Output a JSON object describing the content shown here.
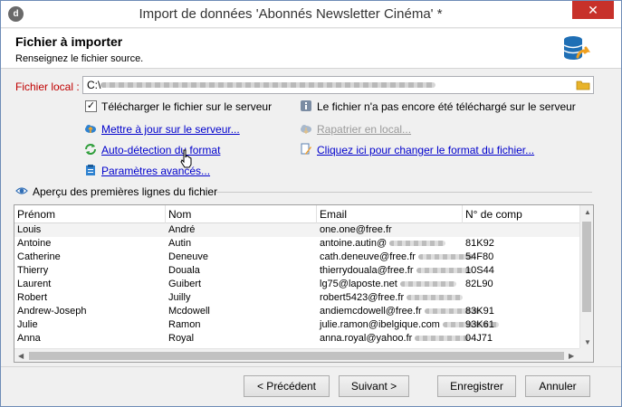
{
  "window": {
    "title": "Import de données 'Abonnés Newsletter Cinéma' *",
    "close_label": "✕",
    "app_icon_glyph": "d"
  },
  "header": {
    "title": "Fichier à importer",
    "subtitle": "Renseignez le fichier source.",
    "icon": "database-import-icon"
  },
  "file": {
    "label": "Fichier local :",
    "path_value": "C:\\"
  },
  "options": {
    "upload_checkbox_label": "Télécharger le fichier sur le serveur",
    "upload_checked": true,
    "status_text": "Le fichier n'a pas encore été téléchargé sur le serveur",
    "update_server_link": "Mettre à jour sur le serveur...",
    "repatriate_link": "Rapatrier en local...",
    "autodetect_link": "Auto-détection du format",
    "change_format_link": "Cliquez ici pour changer le format du fichier...",
    "advanced_params_link": "Paramètres avancés..."
  },
  "preview": {
    "legend": "Aperçu des premières lignes du fichier",
    "columns": [
      "Prénom",
      "Nom",
      "Email",
      "N° de comp"
    ],
    "rows": [
      [
        "Louis",
        "André",
        "one.one@free.fr",
        ""
      ],
      [
        "Antoine",
        "Autin",
        "antoine.autin@",
        "81K92"
      ],
      [
        "Catherine",
        "Deneuve",
        "cath.deneuve@free.fr",
        "54F80"
      ],
      [
        "Thierry",
        "Douala",
        "thierrydouala@free.fr",
        "10S44"
      ],
      [
        "Laurent",
        "Guibert",
        "lg75@laposte.net",
        "82L90"
      ],
      [
        "Robert",
        "Juilly",
        "robert5423@free.fr",
        ""
      ],
      [
        "Andrew-Joseph",
        "Mcdowell",
        "andiemcdowell@free.fr",
        "83K91"
      ],
      [
        "Julie",
        "Ramon",
        "julie.ramon@ibelgique.com",
        "93K61"
      ],
      [
        "Anna",
        "Royal",
        "anna.royal@yahoo.fr",
        "04J71"
      ]
    ]
  },
  "buttons": {
    "previous": "< Précédent",
    "next": "Suivant >",
    "save": "Enregistrer",
    "cancel": "Annuler"
  }
}
